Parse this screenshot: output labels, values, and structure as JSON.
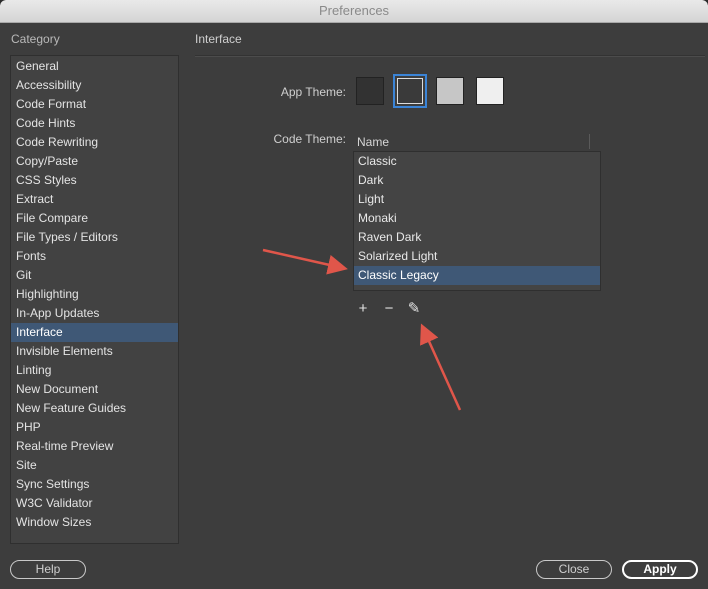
{
  "window": {
    "title": "Preferences"
  },
  "sidebar": {
    "label": "Category",
    "items": [
      "General",
      "Accessibility",
      "Code Format",
      "Code Hints",
      "Code Rewriting",
      "Copy/Paste",
      "CSS Styles",
      "Extract",
      "File Compare",
      "File Types / Editors",
      "Fonts",
      "Git",
      "Highlighting",
      "In-App Updates",
      "Interface",
      "Invisible Elements",
      "Linting",
      "New Document",
      "New Feature Guides",
      "PHP",
      "Real-time Preview",
      "Site",
      "Sync Settings",
      "W3C Validator",
      "Window Sizes"
    ],
    "selected": "Interface"
  },
  "main": {
    "section_title": "Interface",
    "app_theme": {
      "label": "App Theme:",
      "swatches": [
        {
          "name": "darkest",
          "color": "#323232"
        },
        {
          "name": "dark",
          "color": "#3a3a3a",
          "selected": true
        },
        {
          "name": "light",
          "color": "#c6c6c6"
        },
        {
          "name": "lightest",
          "color": "#efefef"
        }
      ]
    },
    "code_theme": {
      "label": "Code Theme:",
      "column_header": "Name",
      "items": [
        "Classic",
        "Dark",
        "Light",
        "Monaki",
        "Raven Dark",
        "Solarized Light",
        "Classic Legacy"
      ],
      "selected": "Classic Legacy",
      "tools": {
        "add": "+",
        "remove": "−",
        "edit": "✎"
      }
    }
  },
  "footer": {
    "help_label": "Help",
    "close_label": "Close",
    "apply_label": "Apply"
  },
  "colors": {
    "selection": "#3f5876",
    "accent": "#3b84d6",
    "annotation_arrow": "#e0564a"
  }
}
